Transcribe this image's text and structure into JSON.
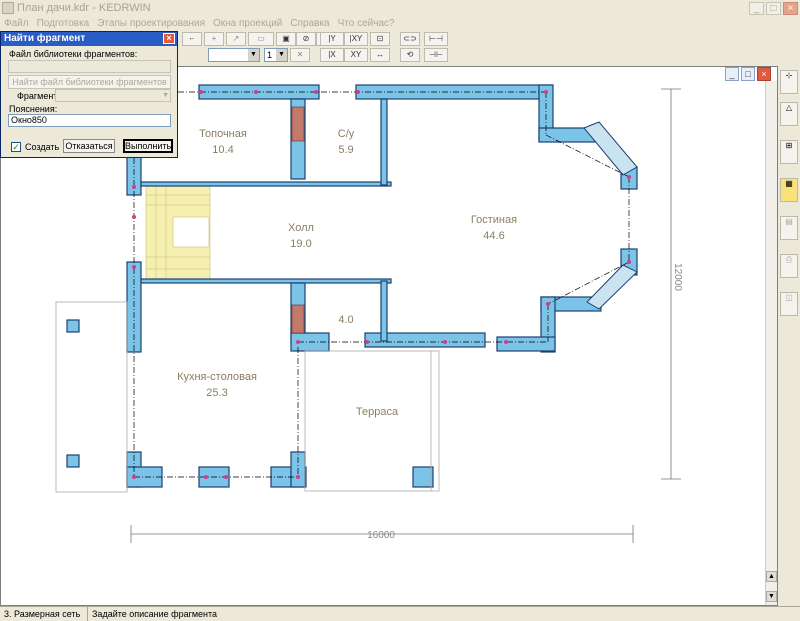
{
  "window": {
    "title": "План дачи.kdr - KEDRWIN",
    "minimize": "_",
    "maximize": "□",
    "close": "×"
  },
  "menu": [
    "Файл",
    "Подготовка",
    "Этапы проектирования",
    "Окна проекций",
    "Справка",
    "Что сейчас?"
  ],
  "toolbar": {
    "layer_value": "1",
    "buttons": [
      "|Y",
      "|XY",
      "|X",
      "XY"
    ]
  },
  "dialog": {
    "title": "Найти фрагмент",
    "close": "×",
    "library_label": "Файл библиотеки фрагментов:",
    "library_value": "",
    "find_library_button": "Найти файл библиотеки фрагментов",
    "fragment_label": "Фрагмент:",
    "fragment_value": "",
    "notes_label": "Пояснения:",
    "notes_value": "Окно850",
    "create_label": "Создать",
    "create_checked": true,
    "cancel_button": "Отказаться",
    "execute_button": "Выполнить"
  },
  "plan": {
    "rooms": [
      {
        "name": "Топочная",
        "area": "10.4"
      },
      {
        "name": "С/у",
        "area": "5.9"
      },
      {
        "name": "Холл",
        "area": "19.0"
      },
      {
        "name": "Гостиная",
        "area": "44.6"
      },
      {
        "name": "Кухня-столовая",
        "area": "25.3"
      },
      {
        "name": "",
        "area": "4.0"
      },
      {
        "name": "Терраса",
        "area": ""
      }
    ],
    "dimension_horizontal": "16000",
    "dimension_vertical": "12000"
  },
  "status": {
    "mode": "3. Размерная сеть",
    "hint": "Задайте описание фрагмента"
  }
}
